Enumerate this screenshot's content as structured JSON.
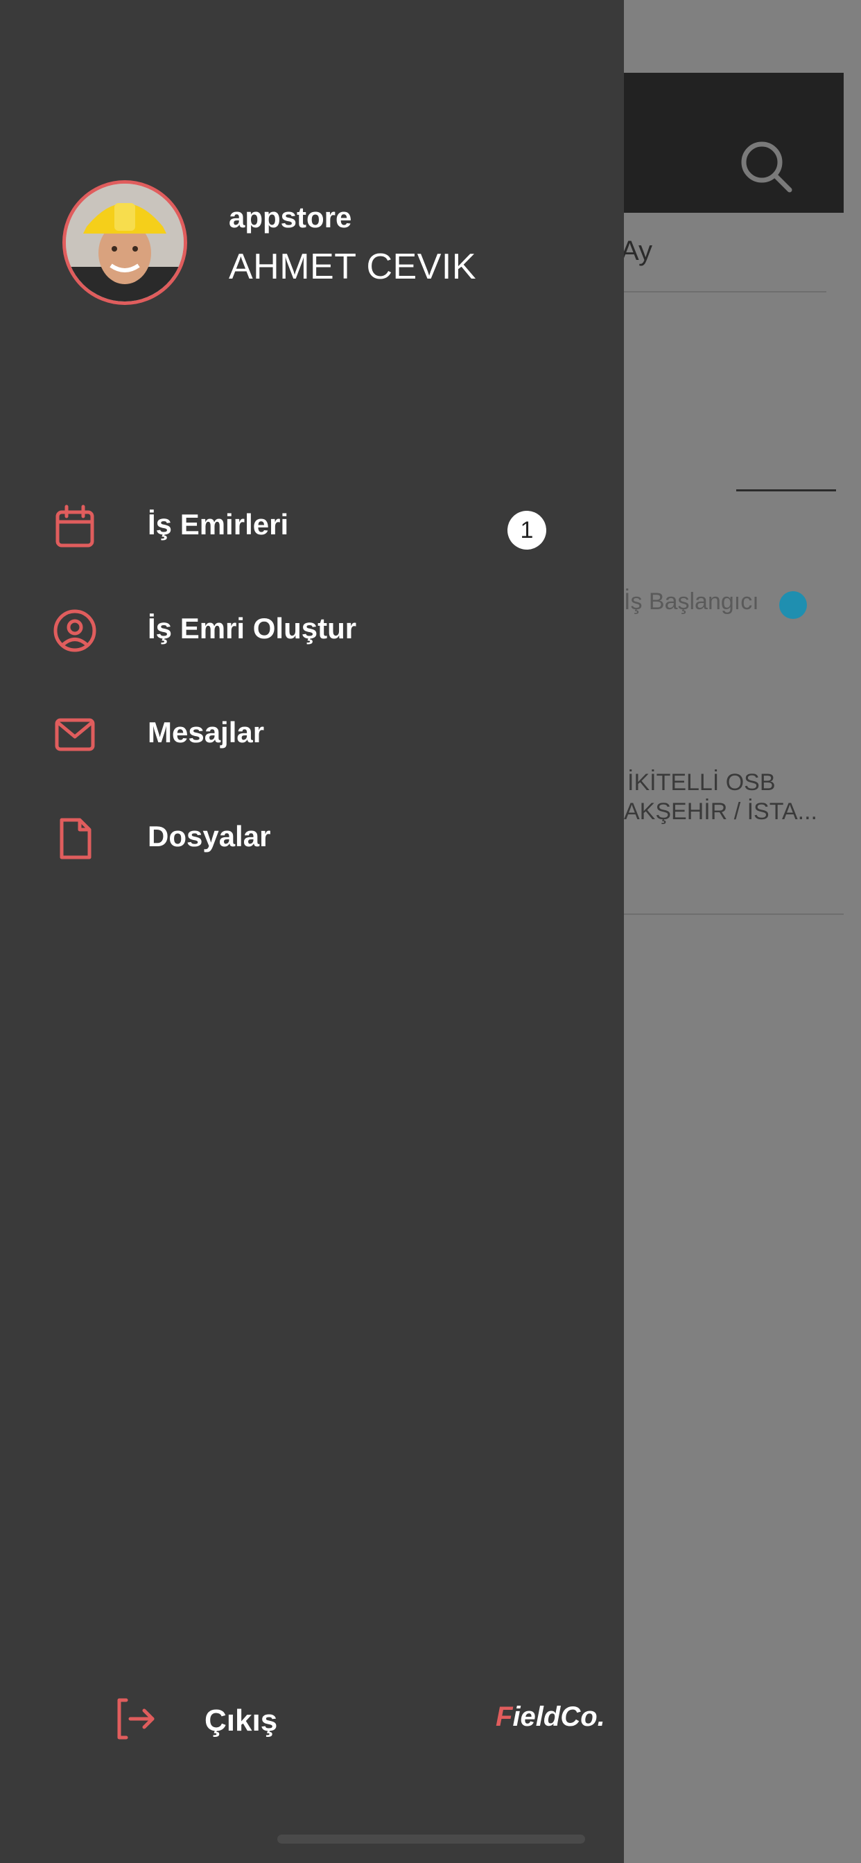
{
  "background": {
    "tab_label": "Ay",
    "status_text": "İş Başlangıcı",
    "address_line1": "İKİTELLİ OSB",
    "address_line2": "AKŞEHİR / İSTA..."
  },
  "profile": {
    "username": "appstore",
    "full_name": "AHMET CEVIK"
  },
  "menu": {
    "items": [
      {
        "label": "İş Emirleri",
        "icon": "calendar-icon",
        "badge": "1"
      },
      {
        "label": "İş Emri Oluştur",
        "icon": "user-circle-icon"
      },
      {
        "label": "Mesajlar",
        "icon": "mail-icon"
      },
      {
        "label": "Dosyalar",
        "icon": "file-icon"
      }
    ]
  },
  "footer": {
    "logout_label": "Çıkış",
    "brand_first": "F",
    "brand_rest": "ieldCo."
  },
  "colors": {
    "drawer_bg": "#3a3a3a",
    "accent": "#e05d5d",
    "overlay": "#808080",
    "status_dot": "#1f8fb0"
  }
}
